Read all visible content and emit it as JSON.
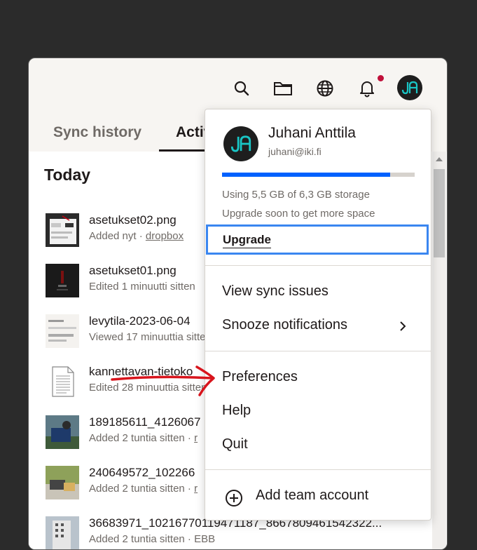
{
  "header": {
    "icons": [
      "search-icon",
      "folder-icon",
      "globe-icon",
      "bell-icon"
    ],
    "avatar_initials": "JA"
  },
  "tabs": [
    {
      "label": "Sync history"
    },
    {
      "label": "Activity"
    }
  ],
  "activity": {
    "section_title": "Today",
    "files": [
      {
        "name": "asetukset02.png",
        "meta": "Added nyt · ",
        "location": "dropbox"
      },
      {
        "name": "asetukset01.png",
        "meta": "Edited 1 minuutti sitten",
        "location": ""
      },
      {
        "name": "levytila-2023-06-04",
        "meta": "Viewed 17 minuuttia sitten",
        "location": ""
      },
      {
        "name": "kannettavan-tietoko",
        "meta": "Edited 28 minuuttia sitten",
        "location": ""
      },
      {
        "name": "189185611_4126067",
        "meta": "Added 2 tuntia sitten · ",
        "location": "r"
      },
      {
        "name": "240649572_102266",
        "meta": "Added 2 tuntia sitten · ",
        "location": "r"
      },
      {
        "name": "36683971_10216770119471187_8667809461542322...",
        "meta": "Added 2 tuntia sitten · ",
        "location": "EBB"
      }
    ]
  },
  "account_menu": {
    "name": "Juhani Anttila",
    "email": "juhani@iki.fi",
    "storage_used_fraction": 0.873,
    "storage_text": "Using 5,5 GB of 6,3 GB storage",
    "storage_hint": "Upgrade soon to get more space",
    "upgrade_label": "Upgrade",
    "items_group1": [
      "View sync issues",
      "Snooze notifications"
    ],
    "items_group2": [
      "Preferences",
      "Help",
      "Quit"
    ],
    "add_team_label": "Add team account"
  },
  "colors": {
    "accent": "#0061fe",
    "focus_outline": "#3a86f0",
    "notification": "#c0103a",
    "annotation_arrow": "#d8141c"
  }
}
